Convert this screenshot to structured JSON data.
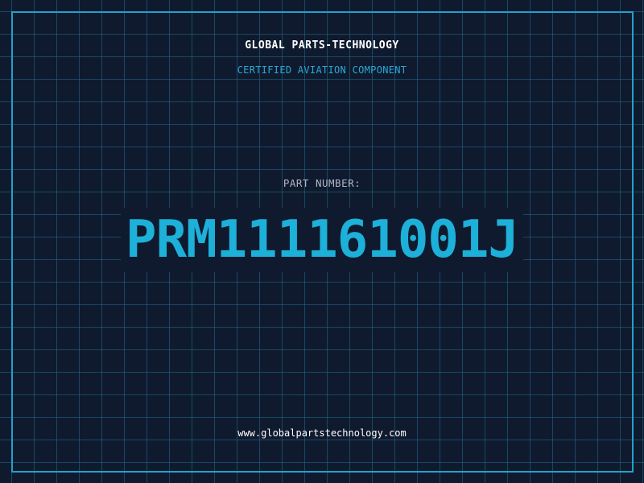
{
  "header": {
    "company": "GLOBAL PARTS-TECHNOLOGY",
    "tagline": "CERTIFIED AVIATION COMPONENT"
  },
  "part": {
    "label": "PART NUMBER:",
    "number": "PRM111161001J"
  },
  "footer": {
    "url": "www.globalpartstechnology.com"
  },
  "colors": {
    "background": "#101a2e",
    "grid": "#1e6e8c",
    "accent": "#1db0d9",
    "text": "#ffffff",
    "muted": "#aeb8c8"
  }
}
